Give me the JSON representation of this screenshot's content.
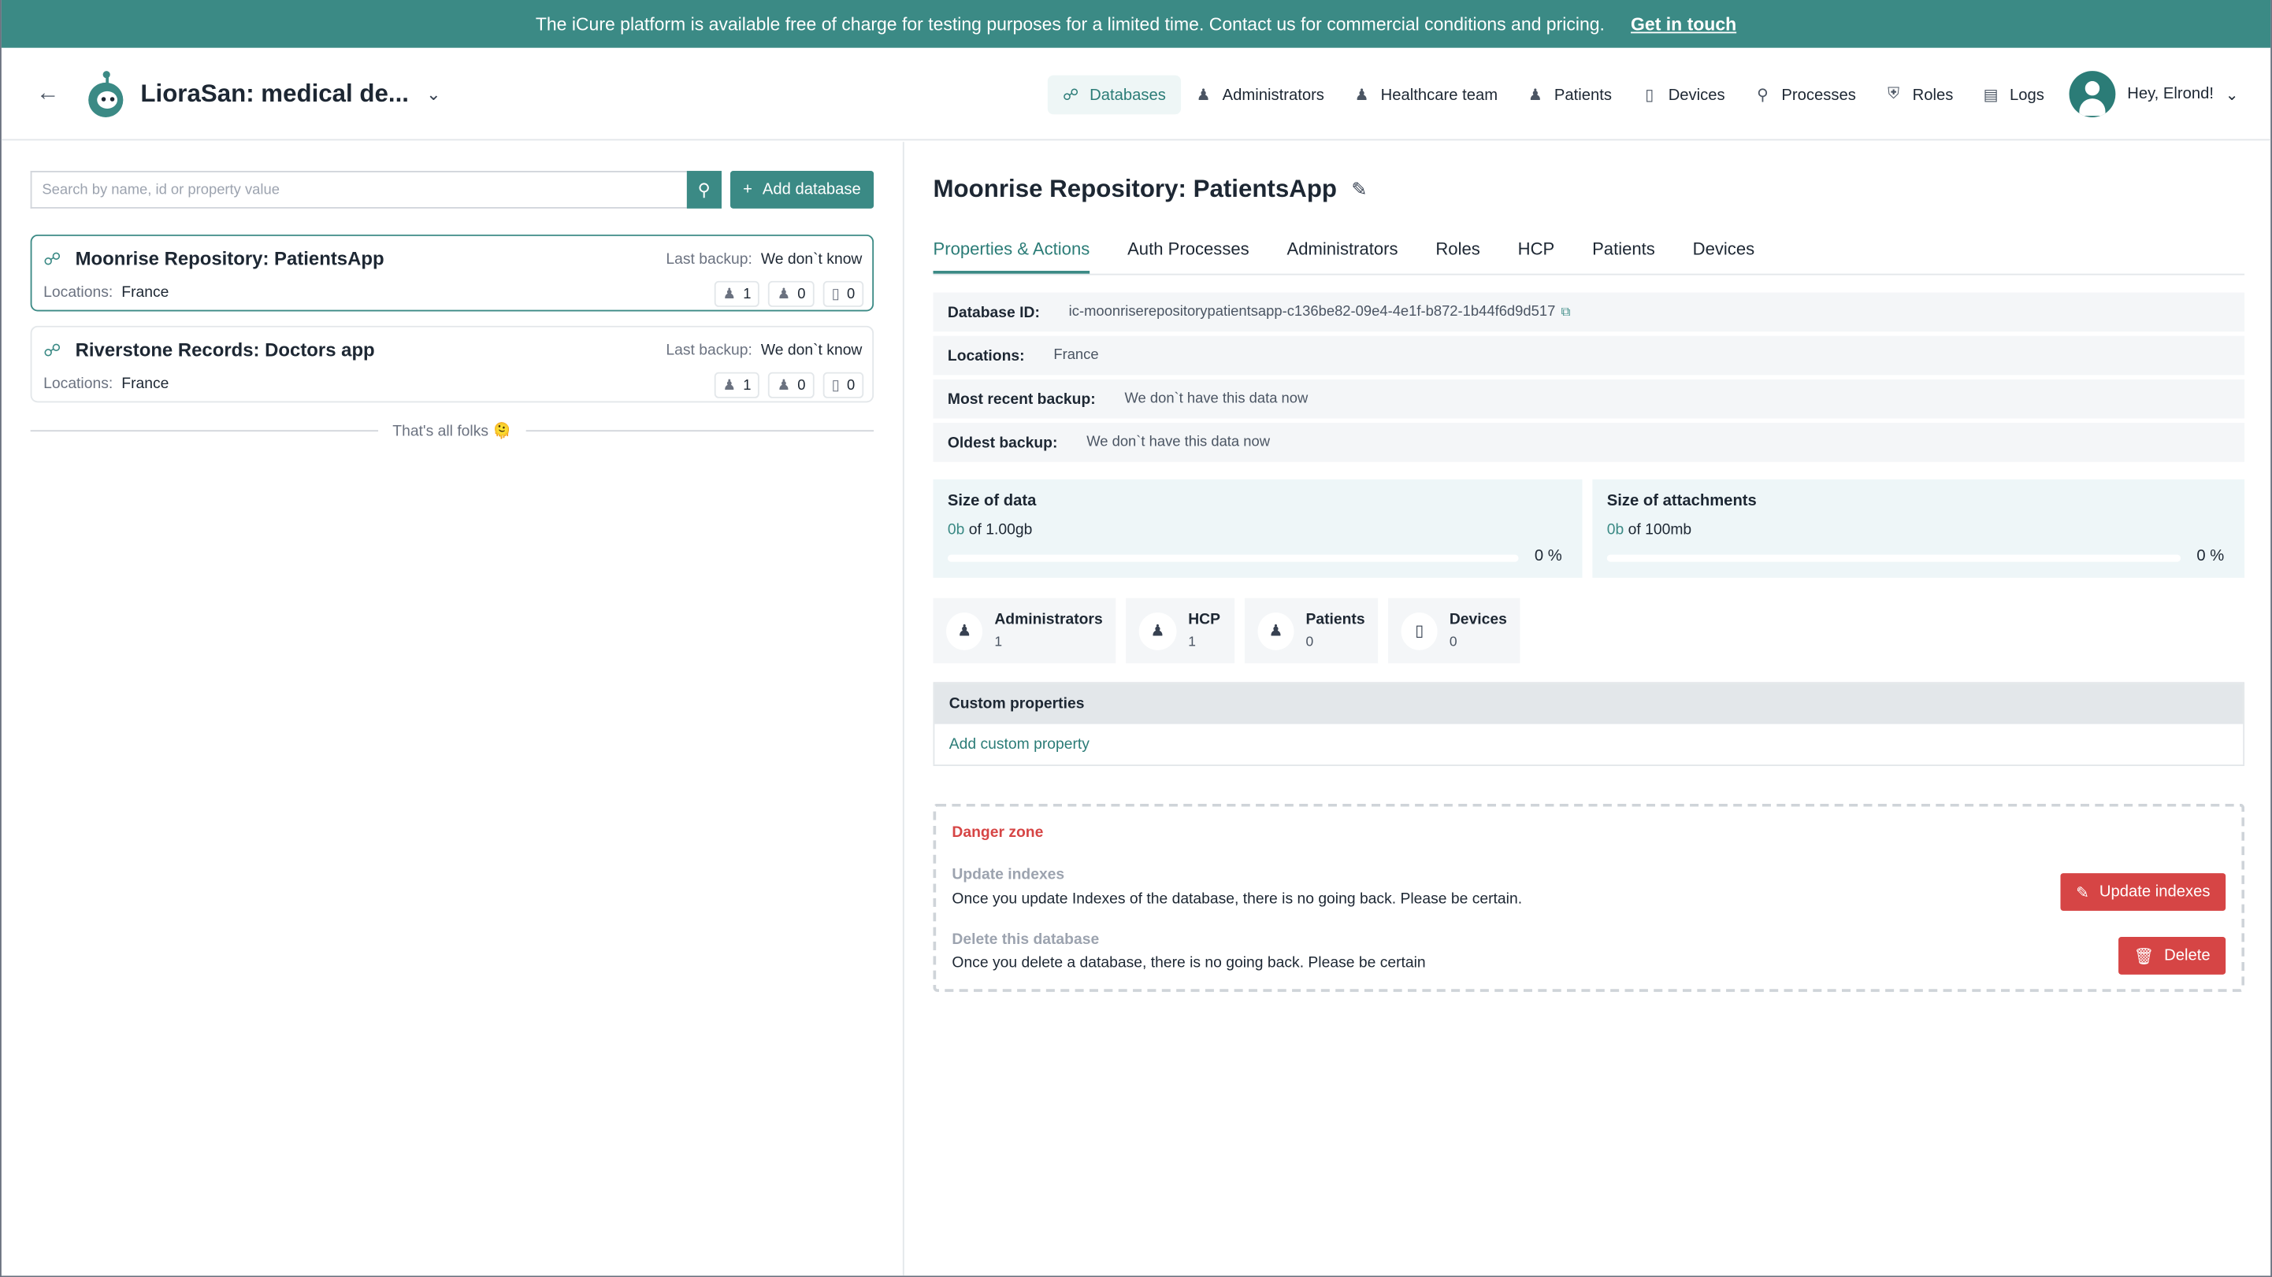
{
  "banner": {
    "text": "The iCure platform is available free of charge for testing purposes for a limited time. Contact us for commercial conditions and pricing.",
    "link": "Get in touch"
  },
  "header": {
    "app_title": "LioraSan: medical de...",
    "nav": [
      {
        "label": "Databases",
        "icon": "databases-icon",
        "active": true
      },
      {
        "label": "Administrators",
        "icon": "administrators-icon"
      },
      {
        "label": "Healthcare team",
        "icon": "healthcare-team-icon"
      },
      {
        "label": "Patients",
        "icon": "patients-icon"
      },
      {
        "label": "Devices",
        "icon": "devices-icon"
      },
      {
        "label": "Processes",
        "icon": "processes-icon"
      },
      {
        "label": "Roles",
        "icon": "roles-icon"
      },
      {
        "label": "Logs",
        "icon": "logs-icon"
      }
    ],
    "user_greeting": "Hey, Elrond!"
  },
  "left": {
    "search_placeholder": "Search by name, id or property value",
    "add_label": "Add database",
    "databases": [
      {
        "name": "Moonrise Repository: PatientsApp",
        "backup_label": "Last backup:",
        "backup_value": "We don`t know",
        "loc_label": "Locations:",
        "loc_value": "France",
        "admins": "1",
        "hcp": "0",
        "devices": "0"
      },
      {
        "name": "Riverstone Records: Doctors app",
        "backup_label": "Last backup:",
        "backup_value": "We don`t know",
        "loc_label": "Locations:",
        "loc_value": "France",
        "admins": "1",
        "hcp": "0",
        "devices": "0"
      }
    ],
    "end_text": "That's all folks 🫠"
  },
  "detail": {
    "title": "Moonrise Repository: PatientsApp",
    "tabs": [
      "Properties & Actions",
      "Auth Processes",
      "Administrators",
      "Roles",
      "HCP",
      "Patients",
      "Devices"
    ],
    "props": [
      {
        "k": "Database ID:",
        "v": "ic-moonriserepositorypatientsapp-c136be82-09e4-4e1f-b872-1b44f6d9d517"
      },
      {
        "k": "Locations:",
        "v": "France"
      },
      {
        "k": "Most recent backup:",
        "v": "We don`t have this data now"
      },
      {
        "k": "Oldest backup:",
        "v": "We don`t have this data now"
      }
    ],
    "size_data": {
      "title": "Size of data",
      "used": "0b",
      "rest": " of 1.00gb",
      "pct": "0 %",
      "fraction": 0
    },
    "size_att": {
      "title": "Size of attachments",
      "used": "0b",
      "rest": " of 100mb",
      "pct": "0 %",
      "fraction": 0
    },
    "counts": [
      {
        "label": "Administrators",
        "num": "1",
        "icon": "administrators-icon"
      },
      {
        "label": "HCP",
        "num": "1",
        "icon": "hcp-icon"
      },
      {
        "label": "Patients",
        "num": "0",
        "icon": "patients-icon"
      },
      {
        "label": "Devices",
        "num": "0",
        "icon": "devices-icon"
      }
    ],
    "custom_head": "Custom properties",
    "custom_add": "Add custom property",
    "danger": {
      "title": "Danger zone",
      "update_label": "Update indexes",
      "update_desc": "Once you update Indexes of the database, there is no going back. Please be certain.",
      "update_btn": "Update indexes",
      "delete_label": "Delete this database",
      "delete_desc": "Once you delete a database, there is no going back. Please be certain",
      "delete_btn": "Delete"
    }
  },
  "colors": {
    "accent": "#3b8a85",
    "danger": "#d64545"
  }
}
